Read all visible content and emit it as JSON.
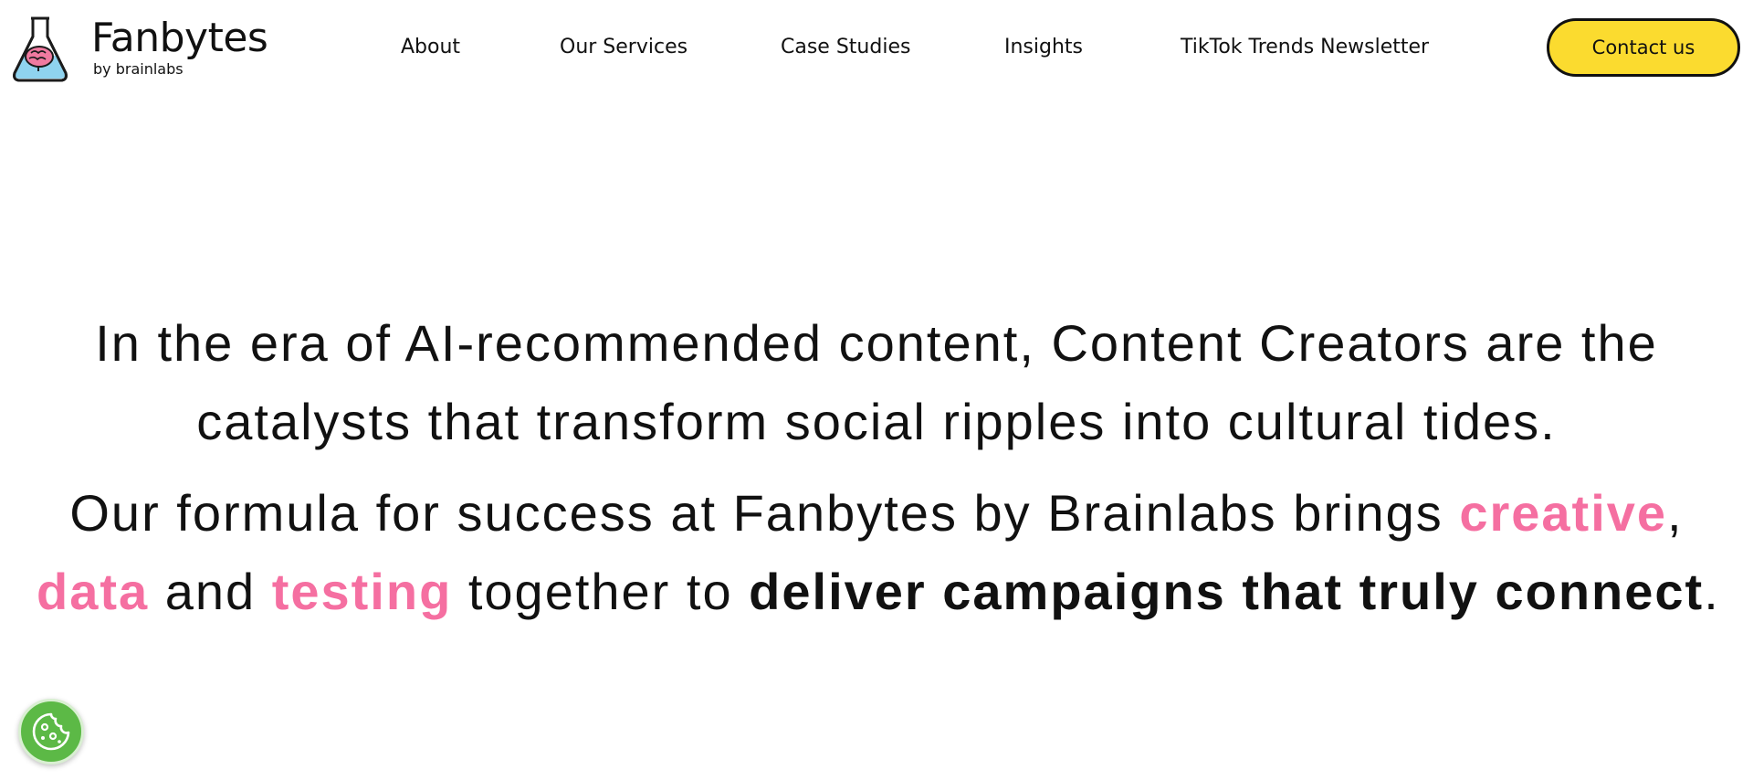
{
  "brand": {
    "name": "Fanbytes",
    "tagline": "by brainlabs",
    "logo_icon": "flask-with-brain-icon"
  },
  "nav": {
    "items": [
      {
        "label": "About"
      },
      {
        "label": "Our Services"
      },
      {
        "label": "Case Studies"
      },
      {
        "label": "Insights"
      },
      {
        "label": "TikTok Trends Newsletter"
      }
    ],
    "cta_label": "Contact us"
  },
  "hero": {
    "line1": "In the era of AI-recommended content, Content Creators are the",
    "line2": "catalysts that transform social ripples into cultural tides.",
    "p2_a": "Our formula for success at Fanbytes by Brainlabs brings ",
    "p2_creative": "creative",
    "p2_comma": ",",
    "p2_data": "data",
    "p2_and": " and ",
    "p2_testing": "testing",
    "p2_together": " together to ",
    "p2_bold": "deliver campaigns that truly connect",
    "p2_end": "."
  },
  "cookie": {
    "icon": "cookie-icon"
  },
  "colors": {
    "accent_pink": "#f56fa1",
    "cta_yellow": "#fbdb2f",
    "cookie_green": "#5cb946",
    "flask_blue": "#8fd3ef",
    "brain_pink": "#f07aa0"
  }
}
